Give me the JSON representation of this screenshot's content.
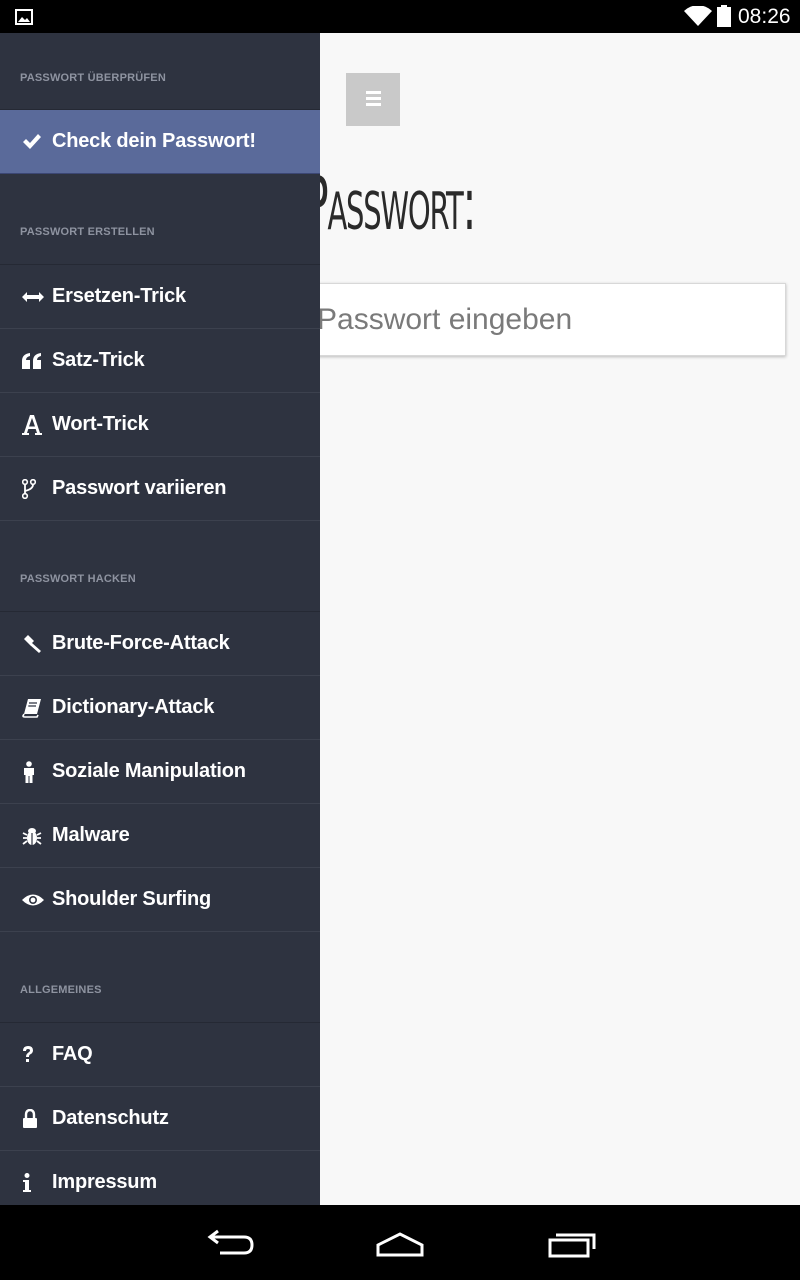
{
  "status_bar": {
    "time": "08:26"
  },
  "main": {
    "heading": "dein Passwort:",
    "input_placeholder": "Passwort eingeben"
  },
  "drawer": {
    "sections": [
      {
        "label": "PASSWORT ÜBERPRÜFEN",
        "items": [
          {
            "label": "Check dein Passwort!",
            "icon": "check-icon",
            "active": true
          }
        ]
      },
      {
        "label": "PASSWORT ERSTELLEN",
        "items": [
          {
            "label": "Ersetzen-Trick",
            "icon": "arrows-h-icon"
          },
          {
            "label": "Satz-Trick",
            "icon": "quote-icon"
          },
          {
            "label": "Wort-Trick",
            "icon": "font-icon"
          },
          {
            "label": "Passwort variieren",
            "icon": "branch-icon"
          }
        ]
      },
      {
        "label": "PASSWORT HACKEN",
        "items": [
          {
            "label": "Brute-Force-Attack",
            "icon": "gavel-icon"
          },
          {
            "label": "Dictionary-Attack",
            "icon": "book-icon"
          },
          {
            "label": "Soziale Manipulation",
            "icon": "person-icon"
          },
          {
            "label": "Malware",
            "icon": "bug-icon"
          },
          {
            "label": "Shoulder Surfing",
            "icon": "eye-icon"
          }
        ]
      },
      {
        "label": "ALLGEMEINES",
        "items": [
          {
            "label": "FAQ",
            "icon": "question-icon"
          },
          {
            "label": "Datenschutz",
            "icon": "lock-icon"
          },
          {
            "label": "Impressum",
            "icon": "info-icon"
          }
        ]
      }
    ]
  },
  "colors": {
    "drawer_bg": "#2e3340",
    "active_item_bg": "#5a6a9a",
    "main_bg": "#f8f8f8"
  }
}
